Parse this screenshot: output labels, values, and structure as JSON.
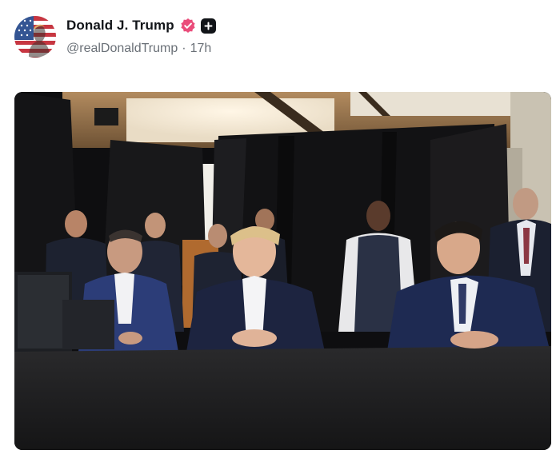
{
  "post": {
    "author": {
      "display_name": "Donald J. Trump",
      "handle": "@realDonaldTrump",
      "verified_icon": "verified-badge-icon",
      "avatar": "avatar-flag-portrait"
    },
    "time_separator": "·",
    "timestamp": "17h",
    "follow_icon": "plus-icon",
    "image": {
      "subject": "photo of people seated at a table in a dark draped room",
      "accent_colors": [
        "#0f0f10",
        "#2a3552",
        "#d9d9d9"
      ]
    }
  }
}
